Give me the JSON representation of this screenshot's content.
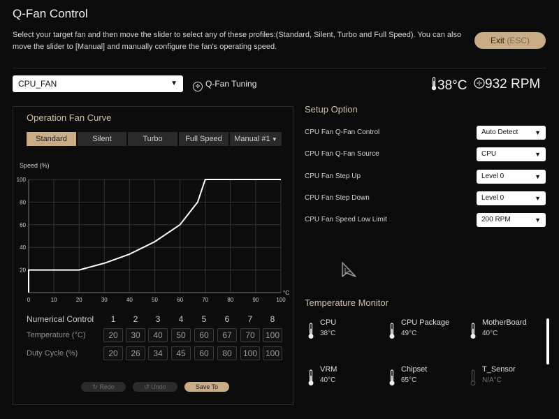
{
  "window": {
    "title": "Q-Fan Control",
    "description": "Select your target fan and then move the slider to select any of these profiles:(Standard, Silent, Turbo and Full Speed). You can also move the slider to [Manual] and manually configure the fan's operating speed.",
    "exit_label": "Exit",
    "exit_shortcut": "(ESC)"
  },
  "header": {
    "fan_selected": "CPU_FAN",
    "tuning_label": "Q-Fan Tuning",
    "temperature": "38°C",
    "rpm": "932 RPM"
  },
  "curve": {
    "title": "Operation Fan Curve",
    "tabs": [
      "Standard",
      "Silent",
      "Turbo",
      "Full Speed",
      "Manual #1"
    ],
    "active_tab": "Standard",
    "y_axis_label": "Speed (%)",
    "x_unit": "°C"
  },
  "chart_data": {
    "type": "line",
    "x": [
      0,
      20,
      30,
      40,
      50,
      60,
      67,
      70,
      100
    ],
    "y": [
      20,
      20,
      26,
      34,
      45,
      60,
      80,
      100,
      100
    ],
    "xlim": [
      0,
      100
    ],
    "ylim": [
      0,
      100
    ],
    "x_ticks": [
      "0",
      "10",
      "20",
      "30",
      "40",
      "50",
      "60",
      "70",
      "80",
      "90",
      "100"
    ],
    "y_ticks": [
      "20",
      "40",
      "60",
      "80",
      "100"
    ],
    "grid": true
  },
  "numerical": {
    "label": "Numerical Control",
    "headers": [
      "1",
      "2",
      "3",
      "4",
      "5",
      "6",
      "7",
      "8"
    ],
    "temperature_label": "Temperature (°C)",
    "temperature": [
      "20",
      "30",
      "40",
      "50",
      "60",
      "67",
      "70",
      "100"
    ],
    "duty_label": "Duty Cycle (%)",
    "duty": [
      "20",
      "26",
      "34",
      "45",
      "60",
      "80",
      "100",
      "100"
    ]
  },
  "actions": {
    "redo": "Redo",
    "undo": "Undo",
    "save": "Save To"
  },
  "setup": {
    "title": "Setup Option",
    "options": [
      {
        "label": "CPU Fan Q-Fan Control",
        "value": "Auto Detect"
      },
      {
        "label": "CPU Fan Q-Fan Source",
        "value": "CPU"
      },
      {
        "label": "CPU Fan Step Up",
        "value": "Level 0"
      },
      {
        "label": "CPU Fan Step Down",
        "value": "Level 0"
      },
      {
        "label": "CPU Fan Speed Low Limit",
        "value": "200 RPM"
      }
    ]
  },
  "monitor": {
    "title": "Temperature Monitor",
    "sensors": [
      {
        "name": "CPU",
        "value": "38°C"
      },
      {
        "name": "CPU Package",
        "value": "49°C"
      },
      {
        "name": "MotherBoard",
        "value": "40°C"
      },
      {
        "name": "VRM",
        "value": "40°C"
      },
      {
        "name": "Chipset",
        "value": "65°C"
      },
      {
        "name": "T_Sensor",
        "value": "N/A°C"
      }
    ]
  },
  "colors": {
    "accent": "#c9ab86",
    "background": "#0b0b0b",
    "panel_border": "#2b2b2b"
  }
}
